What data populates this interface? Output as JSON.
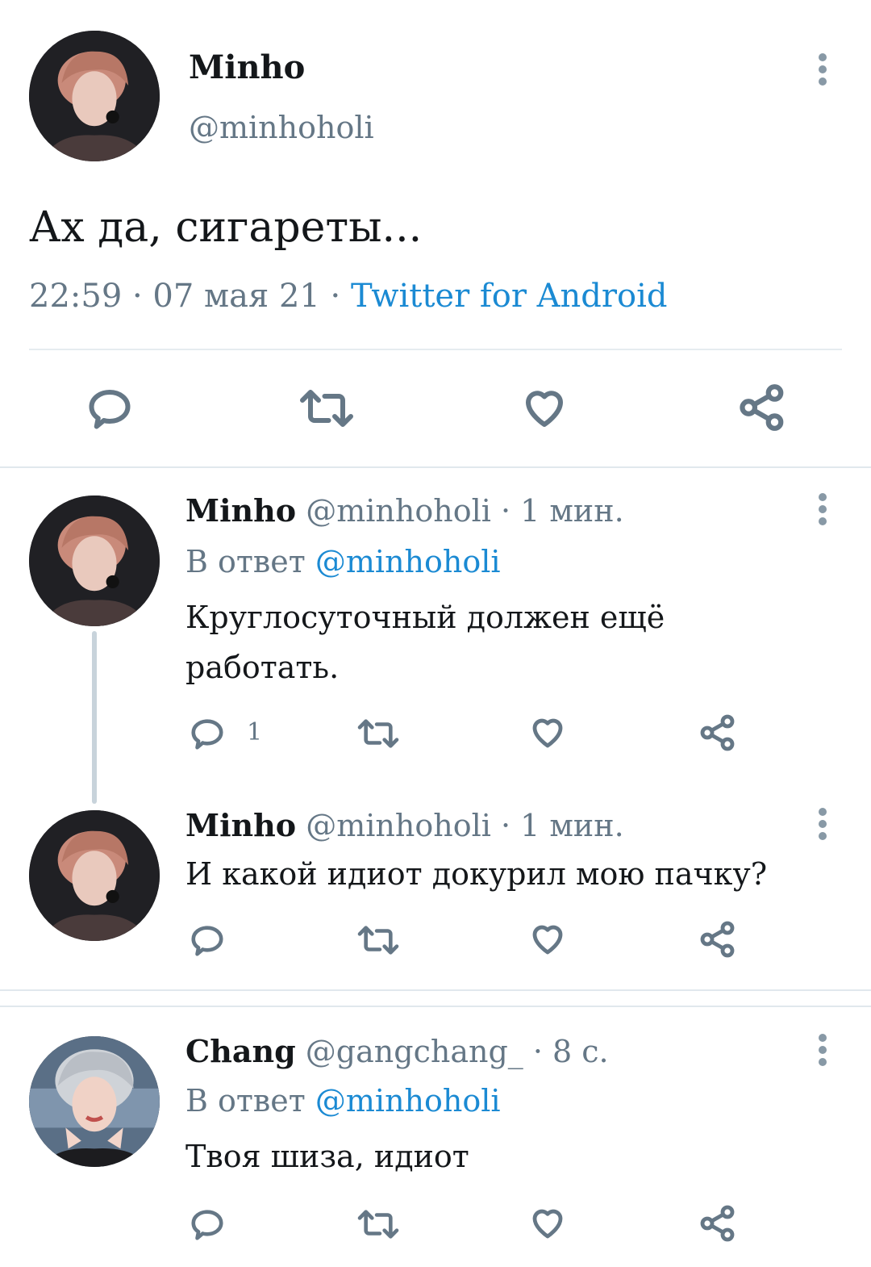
{
  "main_tweet": {
    "name": "Minho",
    "handle": "@minhoholi",
    "text": "Ах да, сигареты...",
    "time": "22:59 · 07 мая 21 · ",
    "source": "Twitter for Android"
  },
  "replies": [
    {
      "name": "Minho",
      "handle_time": "@minhoholi · 1 мин.",
      "reply_prefix": "В ответ ",
      "reply_to": "@minhoholi",
      "text": "Круглосуточный должен ещё работать.",
      "reply_count": "1"
    },
    {
      "name": "Minho",
      "handle_time": "@minhoholi · 1 мин.",
      "text": "И какой идиот докурил мою пачку?"
    },
    {
      "name": "Chang",
      "handle_time": "@gangchang_ · 8 с.",
      "reply_prefix": "В ответ ",
      "reply_to": "@minhoholi",
      "text": "Твоя шиза, идиот"
    }
  ],
  "icons": {
    "reply": "speech-bubble-icon",
    "retweet": "retweet-icon",
    "like": "heart-icon",
    "share": "share-icon",
    "more": "more-vertical-icon"
  },
  "colors": {
    "link": "#1b8ad3",
    "muted": "#657786"
  }
}
